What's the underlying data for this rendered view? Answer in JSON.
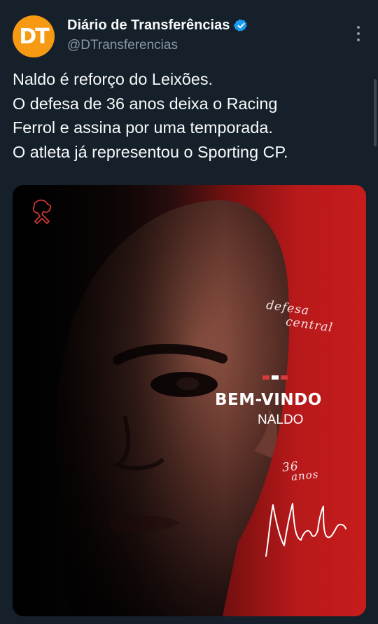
{
  "account": {
    "display_name": "Diário de Transferências",
    "handle": "@DTransferencias",
    "avatar_initials": "DT",
    "avatar_color": "#f59a12",
    "verified": true
  },
  "tweet": {
    "text_lines": [
      "Naldo é reforço do Leixões.",
      "O defesa de 36 anos deixa o Racing",
      "Ferrol e assina por uma temporada.",
      "O atleta já representou o Sporting CP."
    ]
  },
  "media": {
    "position_line1": "defesa",
    "position_line2": "central",
    "welcome": "BEM-VINDO",
    "player_name": "NALDO",
    "age_number": "36",
    "age_word": "anos",
    "signature_text": "Naldo",
    "accent_color": "#c71c1c"
  },
  "icons": {
    "verified": "verified-badge-icon",
    "more": "more-options-icon",
    "club_logo": "club-crest-icon"
  }
}
